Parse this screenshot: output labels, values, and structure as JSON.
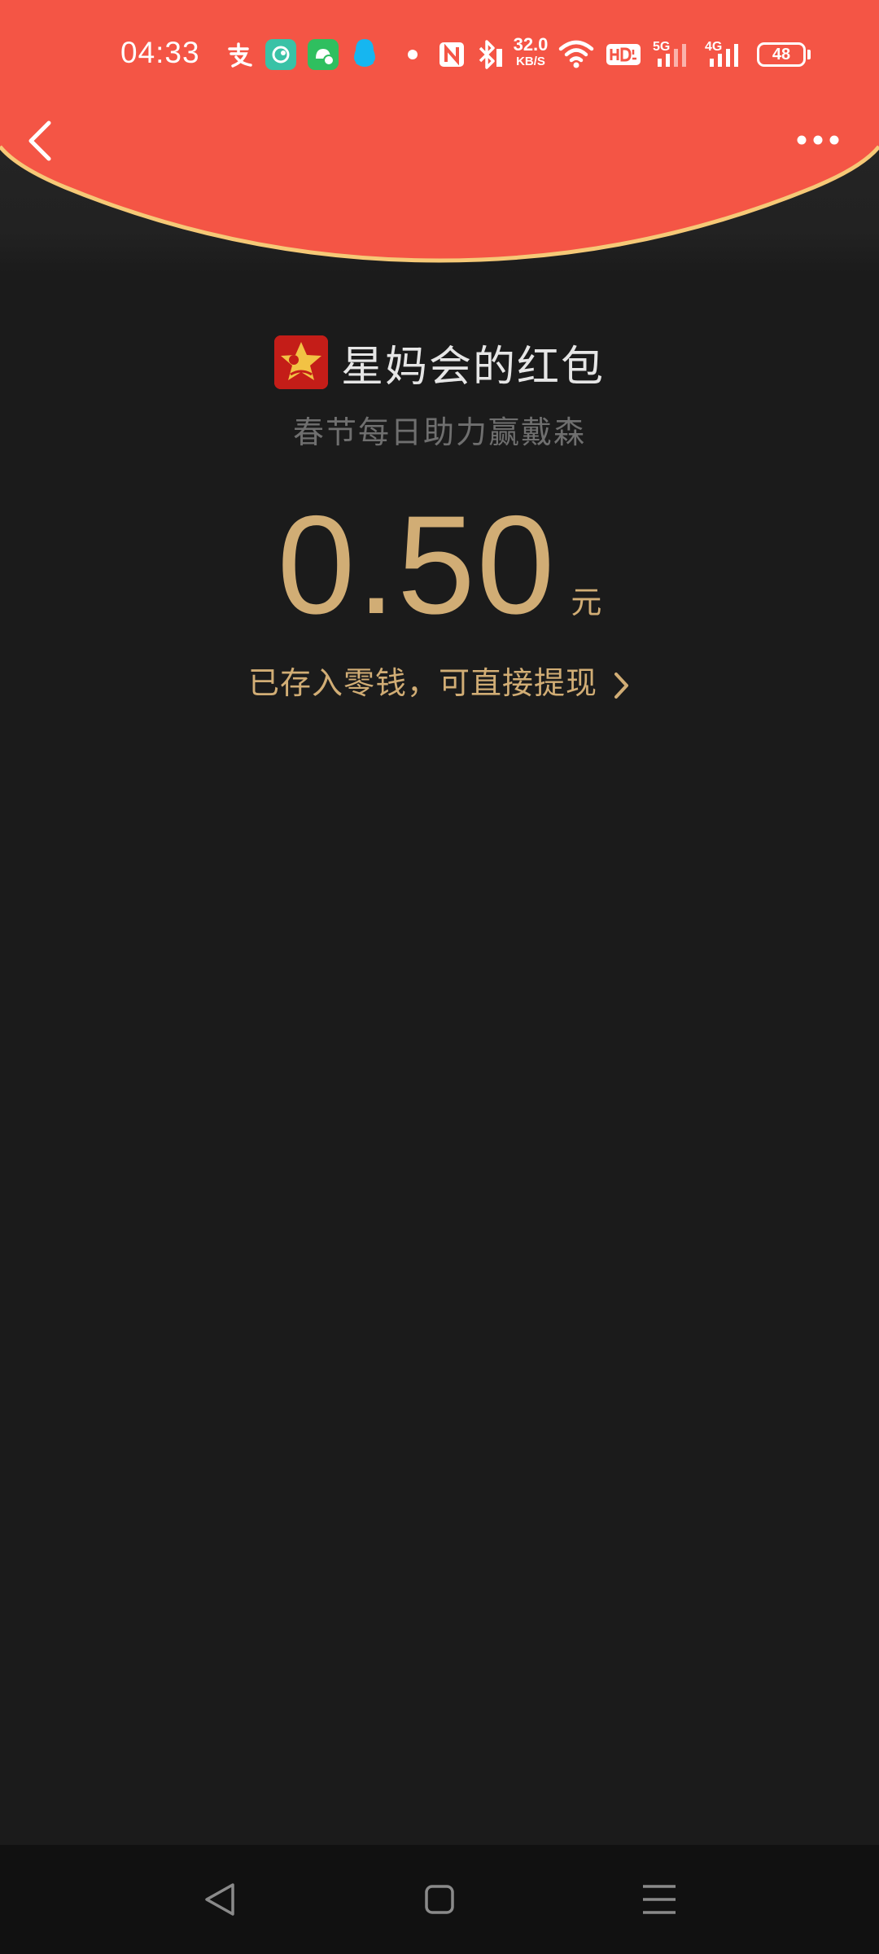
{
  "status_bar": {
    "time": "04:33",
    "net_speed_value": "32.0",
    "net_speed_unit": "KB/S",
    "network_1": "5G",
    "network_2": "4G",
    "battery": "48",
    "icons": [
      "alipay-icon",
      "soul-app-icon",
      "android-app-icon",
      "qq-icon",
      "dot-icon",
      "nfc-icon",
      "bluetooth-icon",
      "wifi-icon",
      "hd-icon",
      "signal-5g-icon",
      "signal-4g-icon",
      "battery-icon"
    ]
  },
  "header": {
    "back_icon": "chevron-left-icon",
    "more_icon": "more-dots-icon",
    "color": "#f45545",
    "edge_color": "#f6c977"
  },
  "envelope": {
    "sender": "星妈会的红包",
    "greeting": "春节每日助力赢戴森",
    "amount": "0.50",
    "unit": "元",
    "deposit_text": "已存入零钱，可直接提现",
    "accent_color": "#d1ad75"
  },
  "nav_bar": {
    "back_icon": "triangle-back-icon",
    "home_icon": "square-home-icon",
    "menu_icon": "menu-lines-icon"
  }
}
